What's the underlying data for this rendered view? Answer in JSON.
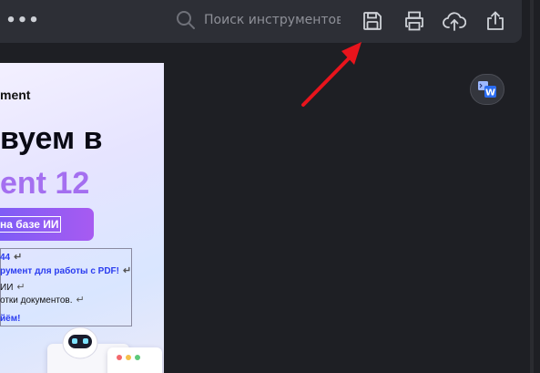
{
  "toolbar": {
    "more_label": "•••",
    "search": {
      "placeholder": "Поиск инструментов",
      "icon": "search-icon"
    },
    "icons": [
      "save-icon",
      "print-icon",
      "cloud-upload-icon",
      "share-icon"
    ]
  },
  "document": {
    "brand": "ment",
    "title": "вуем в",
    "title_accent": "ent 12",
    "ai_button": "на базе ИИ",
    "lines": [
      {
        "text": "44",
        "style": "blue"
      },
      {
        "text": "румент для работы с PDF!",
        "style": "blue"
      },
      {
        "text": "ИИ",
        "style": "normal"
      },
      {
        "text": "отки документов.",
        "style": "normal"
      },
      {
        "text": "йём!",
        "style": "blue"
      }
    ],
    "paragraph_mark": "↵"
  },
  "floating_button": {
    "icon": "convert-to-word-icon",
    "letter": "W"
  },
  "colors": {
    "toolbar_bg": "#2d2f36",
    "app_bg": "#1e1f24",
    "accent_purple": "#a46ff0",
    "annotation_arrow": "#e8141c",
    "word_blue": "#2b6cf0"
  }
}
